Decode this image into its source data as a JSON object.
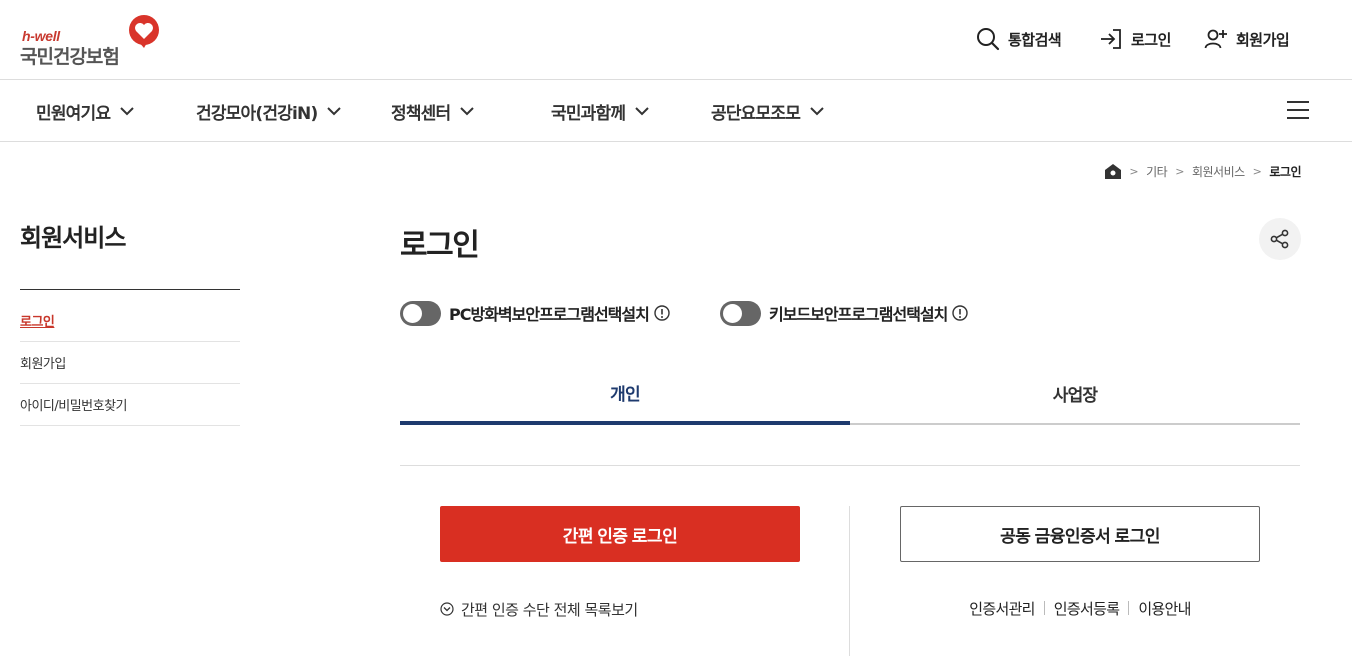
{
  "logo": {
    "brand": "h-well",
    "name": "국민건강보험"
  },
  "utility": [
    {
      "label": "통합검색",
      "icon": "search-icon"
    },
    {
      "label": "로그인",
      "icon": "login-icon"
    },
    {
      "label": "회원가입",
      "icon": "user-plus-icon"
    }
  ],
  "gnb": [
    {
      "label": "민원여기요"
    },
    {
      "label": "건강모아(건강iN)"
    },
    {
      "label": "정책센터"
    },
    {
      "label": "국민과함께"
    },
    {
      "label": "공단요모조모"
    }
  ],
  "breadcrumb": {
    "items": [
      "기타",
      "회원서비스"
    ],
    "current": "로그인"
  },
  "lnb": {
    "title": "회원서비스",
    "items": [
      {
        "label": "로그인",
        "active": true
      },
      {
        "label": "회원가입",
        "active": false
      },
      {
        "label": "아이디/비밀번호찾기",
        "active": false
      }
    ]
  },
  "main": {
    "title": "로그인",
    "toggles": [
      {
        "label": "PC방화벽보안프로그램선택설치",
        "on": false
      },
      {
        "label": "키보드보안프로그램선택설치",
        "on": false
      }
    ],
    "tabs": [
      {
        "label": "개인",
        "selected": true
      },
      {
        "label": "사업장",
        "selected": false
      }
    ],
    "simple_login_button": "간편 인증 로그인",
    "cert_login_button": "공동 금융인증서 로그인",
    "simple_list_link": "간편 인증 수단 전체 목록보기",
    "cert_links": [
      "인증서관리",
      "인증서등록",
      "이용안내"
    ]
  },
  "colors": {
    "accent_red": "#d92f22",
    "tab_navy": "#1e3a6e"
  }
}
